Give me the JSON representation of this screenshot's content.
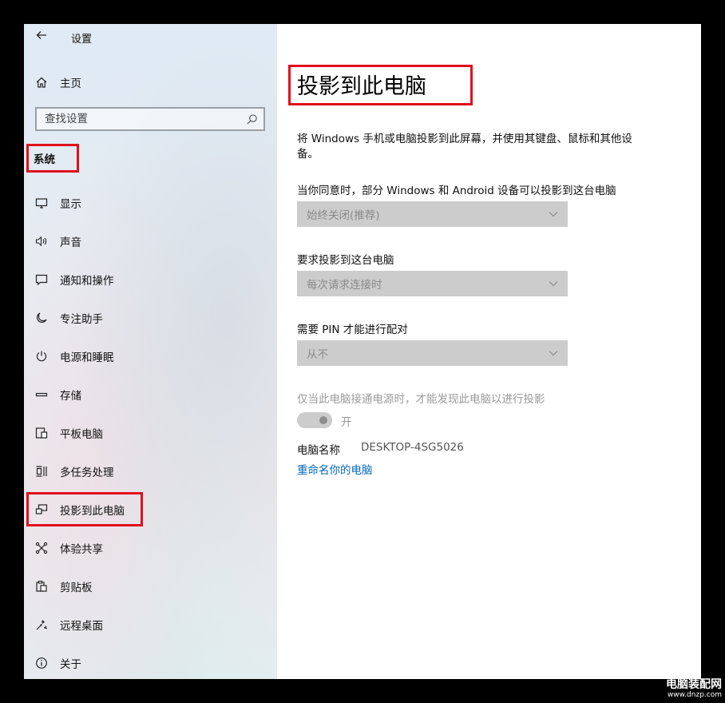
{
  "window": {
    "title": "设置"
  },
  "sidebar": {
    "home_label": "主页",
    "search_placeholder": "查找设置",
    "section_title": "系统",
    "items": [
      {
        "label": "显示",
        "icon": "monitor-icon"
      },
      {
        "label": "声音",
        "icon": "speaker-icon"
      },
      {
        "label": "通知和操作",
        "icon": "notification-icon"
      },
      {
        "label": "专注助手",
        "icon": "moon-icon"
      },
      {
        "label": "电源和睡眠",
        "icon": "power-icon"
      },
      {
        "label": "存储",
        "icon": "storage-icon"
      },
      {
        "label": "平板电脑",
        "icon": "tablet-icon"
      },
      {
        "label": "多任务处理",
        "icon": "multitask-icon"
      },
      {
        "label": "投影到此电脑",
        "icon": "project-icon"
      },
      {
        "label": "体验共享",
        "icon": "share-icon"
      },
      {
        "label": "剪贴板",
        "icon": "clipboard-icon"
      },
      {
        "label": "远程桌面",
        "icon": "remote-desktop-icon"
      },
      {
        "label": "关于",
        "icon": "info-icon"
      }
    ]
  },
  "main": {
    "title": "投影到此电脑",
    "description": "将 Windows 手机或电脑投影到此屏幕，并使用其键盘、鼠标和其他设备。",
    "settings": [
      {
        "label": "当你同意时，部分 Windows 和 Android 设备可以投影到这台电脑",
        "value": "始终关闭(推荐)"
      },
      {
        "label": "要求投影到这台电脑",
        "value": "每次请求连接时"
      },
      {
        "label": "需要 PIN 才能进行配对",
        "value": "从不"
      }
    ],
    "power_only_label": "仅当此电脑接通电源时，才能发现此电脑以进行投影",
    "power_toggle_label": "开",
    "pc_name_label": "电脑名称",
    "pc_name_value": "DESKTOP-4SG5026",
    "rename_link": "重命名你的电脑"
  },
  "watermark": {
    "line1": "电脑装配网",
    "line2": "www.dnzp.com"
  },
  "colors": {
    "highlight_box": "#e0101c",
    "link": "#0067c0",
    "disabled_control": "#cccccc"
  }
}
